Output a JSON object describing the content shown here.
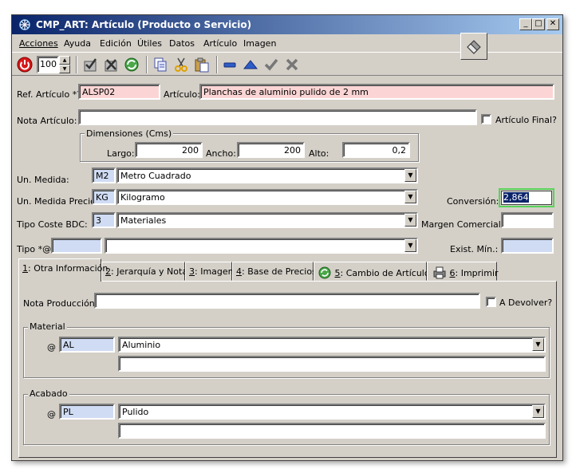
{
  "window": {
    "title": "CMP_ART: Artículo (Producto o Servicio)",
    "minimize": "_",
    "maximize": "□",
    "close": "✕"
  },
  "menu": [
    {
      "label": "Acciones"
    },
    {
      "label": "Ayuda"
    },
    {
      "label": "Edición"
    },
    {
      "label": "Útiles"
    },
    {
      "label": "Datos"
    },
    {
      "label": "Artículo"
    },
    {
      "label": "Imagen"
    }
  ],
  "toolbar": {
    "zoom": "100",
    "icons": [
      "power-icon",
      "spinner-icon",
      "check-form-icon",
      "delete-form-icon",
      "refresh-icon",
      "copy-icon",
      "cut-icon",
      "paste-icon",
      "minus-icon",
      "triangle-up-icon",
      "checkmark-icon",
      "x-icon"
    ]
  },
  "form": {
    "ref_label": "Ref. Artículo *?",
    "ref_value": "ALSP02",
    "articulo_label": "Artículo:",
    "articulo_value": "Planchas de aluminio pulido de 2 mm",
    "nota_label": "Nota Artículo:",
    "nota_value": "",
    "final_label": "Artículo Final?",
    "dimensiones_title": "Dimensiones (Cms)",
    "largo_label": "Largo:",
    "largo_value": "200",
    "ancho_label": "Ancho:",
    "ancho_value": "200",
    "alto_label": "Alto:",
    "alto_value": "0,2",
    "um_label": "Un. Medida:",
    "um_code": "M2",
    "um_value": "Metro Cuadrado",
    "ump_label": "Un. Medida Precio:",
    "ump_code": "KG",
    "ump_value": "Kilogramo",
    "conversion_label": "Conversión:",
    "conversion_value": "2,864",
    "tc_label": "Tipo Coste BDC:",
    "tc_code": "3",
    "tc_value": "Materiales",
    "margen_label": "Margen Comercial:",
    "margen_value": "",
    "tipo_label": "Tipo *@",
    "tipo_code": "",
    "tipo_value": "",
    "exist_label": "Exist. Mín.:",
    "exist_value": ""
  },
  "tabs": [
    {
      "key": "1",
      "label": ": Otra Información"
    },
    {
      "key": "2",
      "label": ": Jerarquía y Notas"
    },
    {
      "key": "3",
      "label": ": Imagen"
    },
    {
      "key": "4",
      "label": ": Base de Precios"
    },
    {
      "key": "5",
      "label": ": Cambio de Artículo"
    },
    {
      "key": "6",
      "label": ": Imprimir"
    }
  ],
  "tab_content": {
    "nota_prod_label": "Nota Producción:",
    "nota_prod_value": "",
    "devolver_label": "A Devolver?",
    "material_title": "Material",
    "material_at": "@",
    "material_code": "AL",
    "material_value": "Aluminio",
    "material_extra": "",
    "acabado_title": "Acabado",
    "acabado_at": "@",
    "acabado_code": "PL",
    "acabado_value": "Pulido",
    "acabado_extra": ""
  },
  "colors": {
    "titlebar_start": "#0a246a",
    "titlebar_end": "#a6caf0",
    "window_bg": "#d4d0c8",
    "required_field": "#fbd5d5",
    "code_field": "#d0dcf4",
    "focus_border": "#5ad35a"
  }
}
